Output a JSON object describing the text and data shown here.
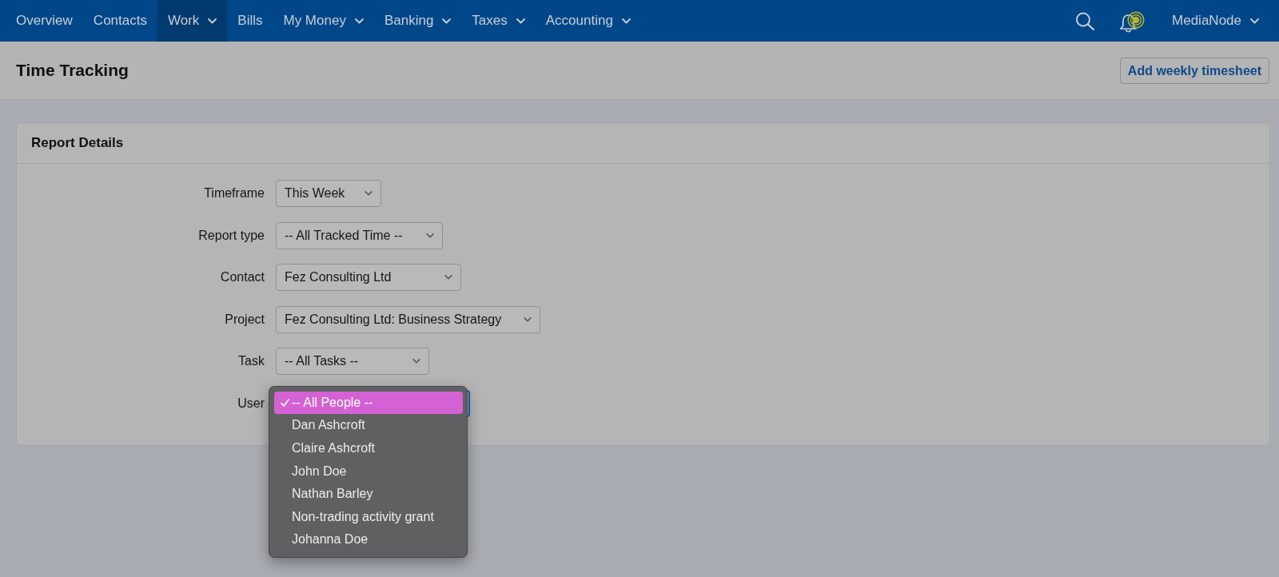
{
  "nav": {
    "items": [
      {
        "label": "Overview",
        "menu": false,
        "selected": false
      },
      {
        "label": "Contacts",
        "menu": false,
        "selected": false
      },
      {
        "label": "Work",
        "menu": true,
        "selected": true
      },
      {
        "label": "Bills",
        "menu": false,
        "selected": false
      },
      {
        "label": "My Money",
        "menu": true,
        "selected": false
      },
      {
        "label": "Banking",
        "menu": true,
        "selected": false
      },
      {
        "label": "Taxes",
        "menu": true,
        "selected": false
      },
      {
        "label": "Accounting",
        "menu": true,
        "selected": false
      }
    ],
    "notifications": {
      "unread": true
    },
    "account": {
      "label": "MediaNode",
      "menu": true
    }
  },
  "header": {
    "title": "Time Tracking",
    "button": "Add weekly timesheet"
  },
  "report": {
    "title": "Report Details",
    "fields": [
      {
        "label": "Timeframe",
        "value": "This Week"
      },
      {
        "label": "Report type",
        "value": "-- All Tracked Time --"
      },
      {
        "label": "Contact",
        "value": "Fez Consulting Ltd"
      },
      {
        "label": "Project",
        "value": "Fez Consulting Ltd: Business Strategy"
      },
      {
        "label": "Task",
        "value": "-- All Tasks --"
      },
      {
        "label": "User",
        "expanded": true,
        "options": [
          {
            "label": "-- All People --",
            "selected": true
          },
          {
            "label": "Dan Ashcroft",
            "selected": false
          },
          {
            "label": "Claire Ashcroft",
            "selected": false
          },
          {
            "label": "John Doe",
            "selected": false
          },
          {
            "label": "Nathan Barley",
            "selected": false
          },
          {
            "label": "Non-trading activity grant",
            "selected": false
          },
          {
            "label": "Johanna Doe",
            "selected": false
          }
        ]
      }
    ]
  }
}
